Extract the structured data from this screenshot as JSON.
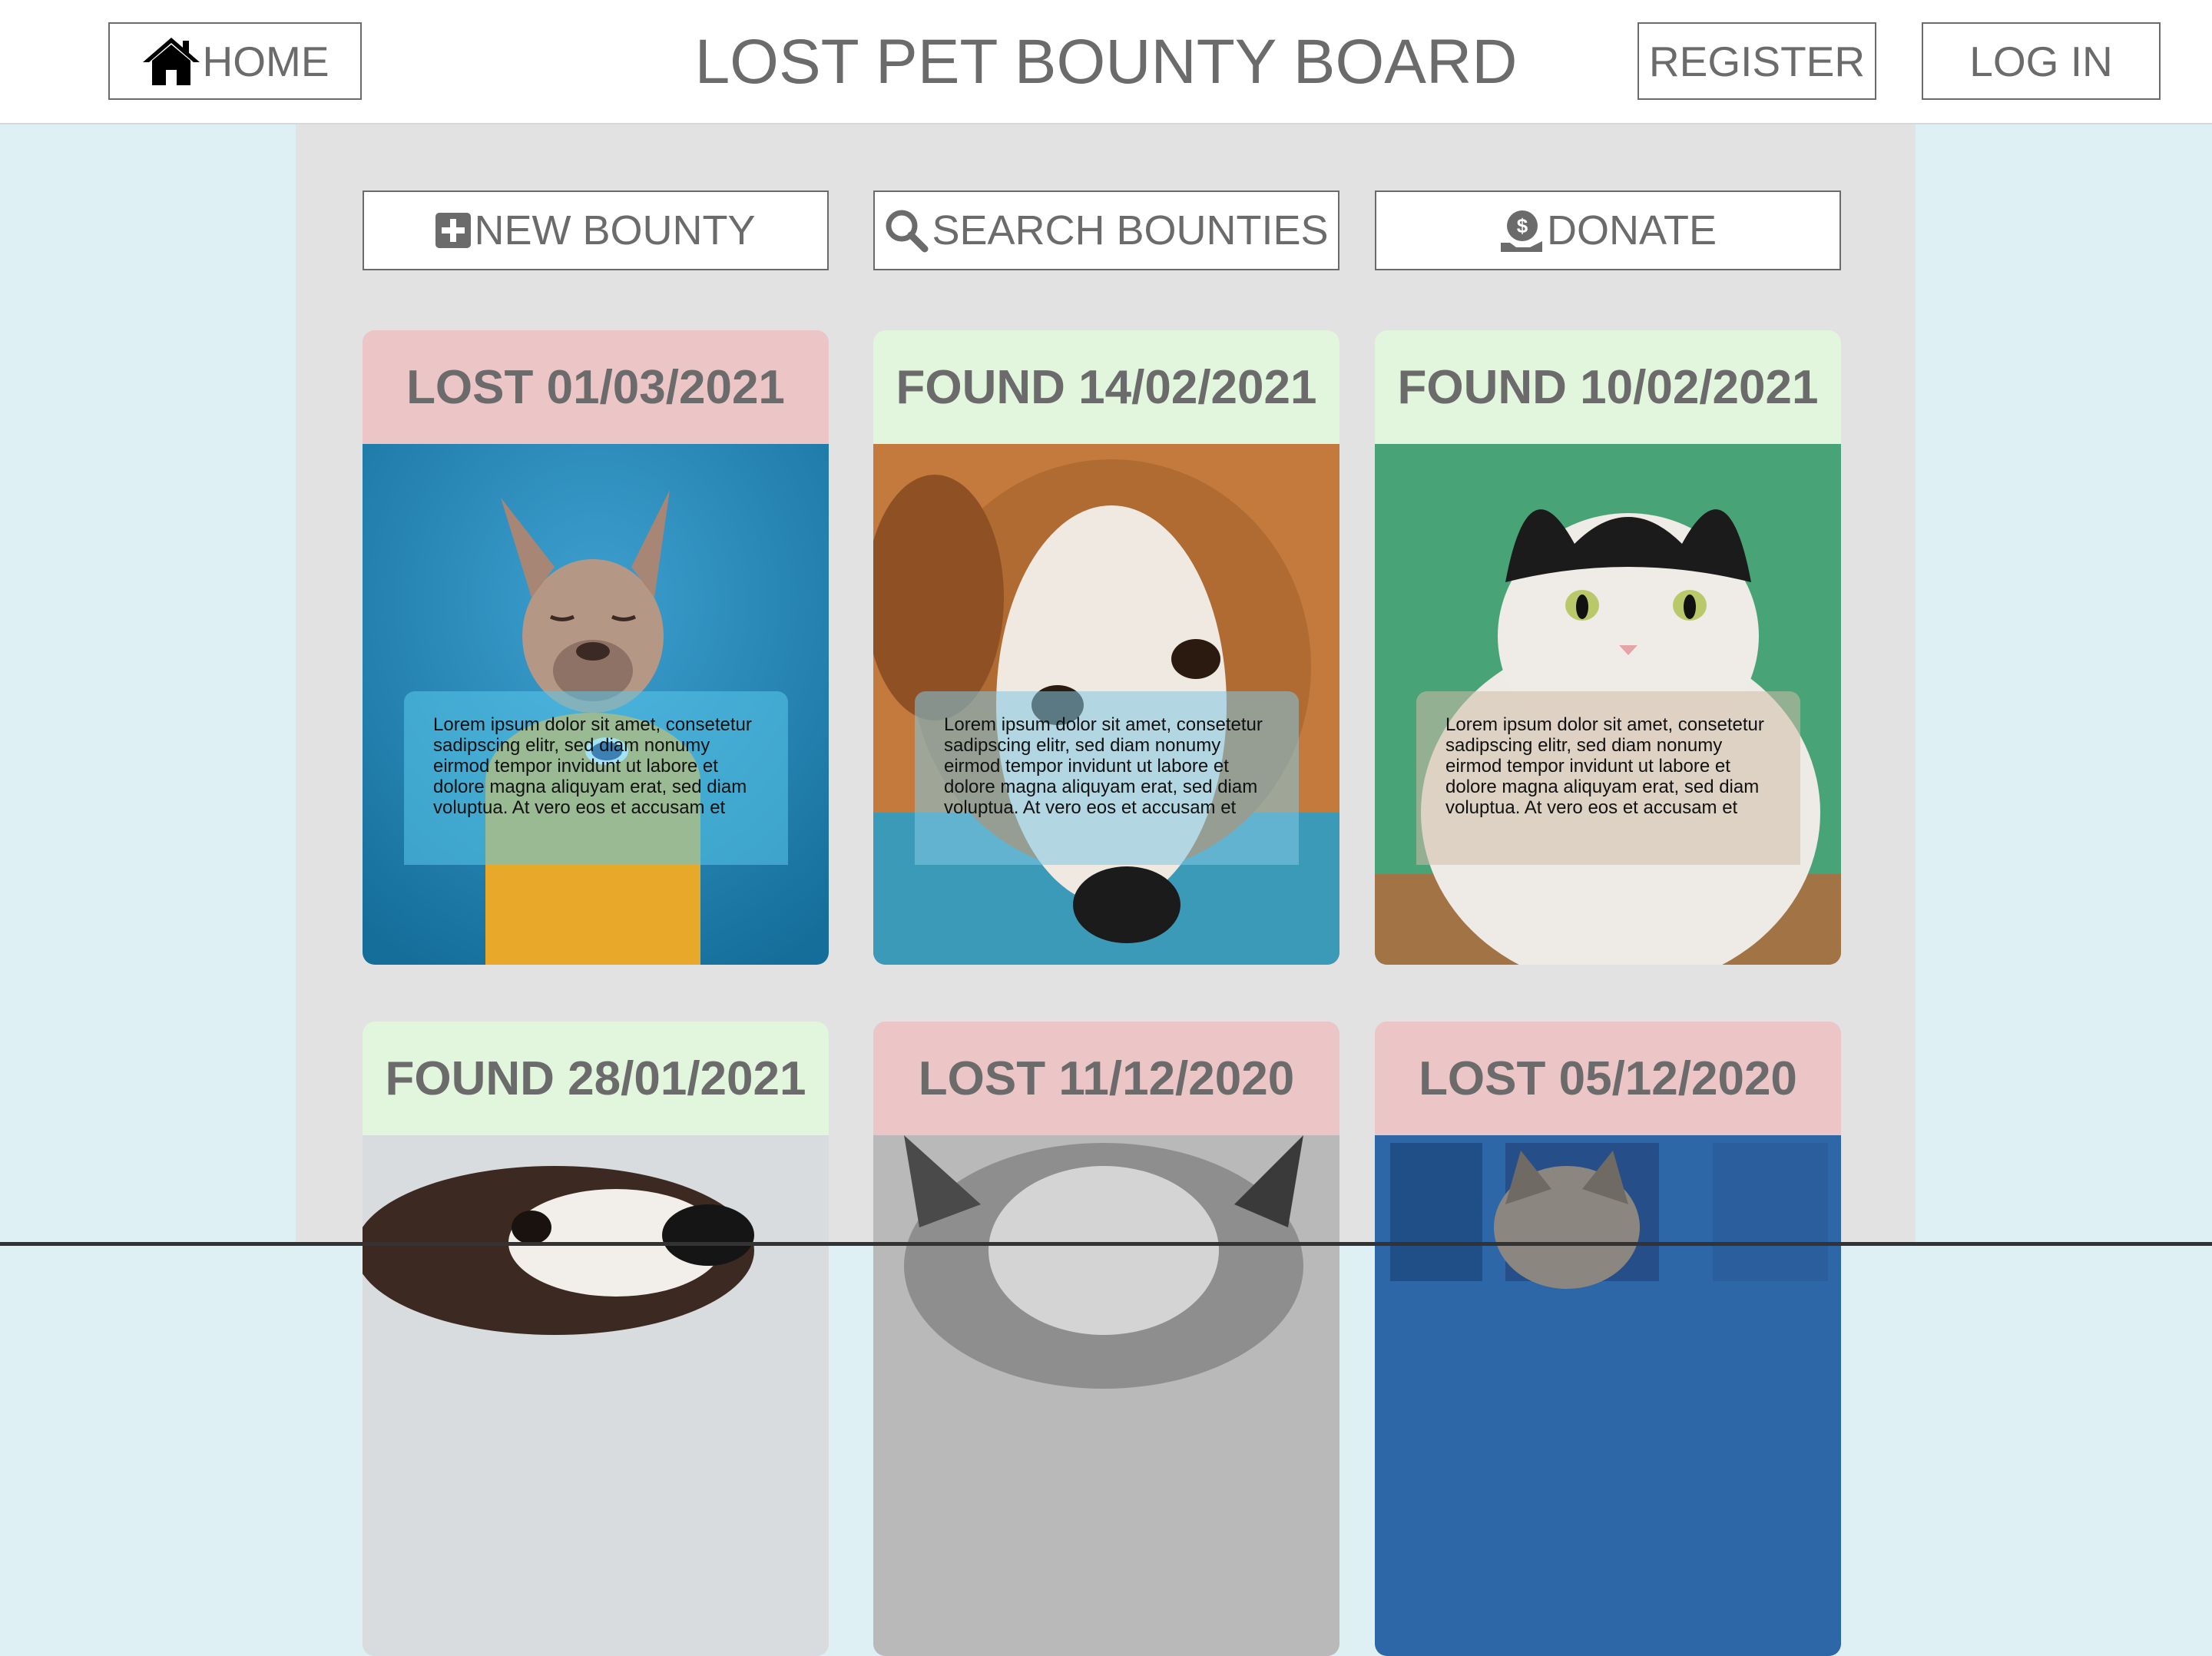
{
  "header": {
    "home_label": "HOME",
    "title": "LOST PET BOUNTY BOARD",
    "register_label": "REGISTER",
    "login_label": "LOG IN"
  },
  "actions": {
    "new_bounty": "NEW BOUNTY",
    "search_bounties": "SEARCH BOUNTIES",
    "donate": "DONATE"
  },
  "cards": [
    {
      "status": "lost",
      "title": "LOST 01/03/2021",
      "animal": "french bulldog in yellow sweater",
      "description": "Lorem ipsum dolor sit amet, consetetur sadipscing elitr, sed diam nonumy eirmod tempor invidunt ut labore et dolore magna aliquyam erat, sed diam voluptua. At vero eos et accusam et"
    },
    {
      "status": "found",
      "title": "FOUND 14/02/2021",
      "animal": "terrier dog lying down",
      "description": "Lorem ipsum dolor sit amet, consetetur sadipscing elitr, sed diam nonumy eirmod tempor invidunt ut labore et dolore magna aliquyam erat, sed diam voluptua. At vero eos et accusam et"
    },
    {
      "status": "found",
      "title": "FOUND 10/02/2021",
      "animal": "black and white cat",
      "description": "Lorem ipsum dolor sit amet, consetetur sadipscing elitr, sed diam nonumy eirmod tempor invidunt ut labore et dolore magna aliquyam erat, sed diam voluptua. At vero eos et accusam et"
    },
    {
      "status": "found",
      "title": "FOUND 28/01/2021",
      "animal": "beagle dog"
    },
    {
      "status": "lost",
      "title": "LOST 11/12/2020",
      "animal": "grey fluffy cat"
    },
    {
      "status": "lost",
      "title": "LOST 05/12/2020",
      "animal": "tabby cat by window"
    }
  ],
  "colors": {
    "lost_header": "#ecc5c7",
    "found_header": "#e2f5dd",
    "panel": "#e2e2e2",
    "page_background": "#dff0f5",
    "text": "#6b6b6b"
  }
}
